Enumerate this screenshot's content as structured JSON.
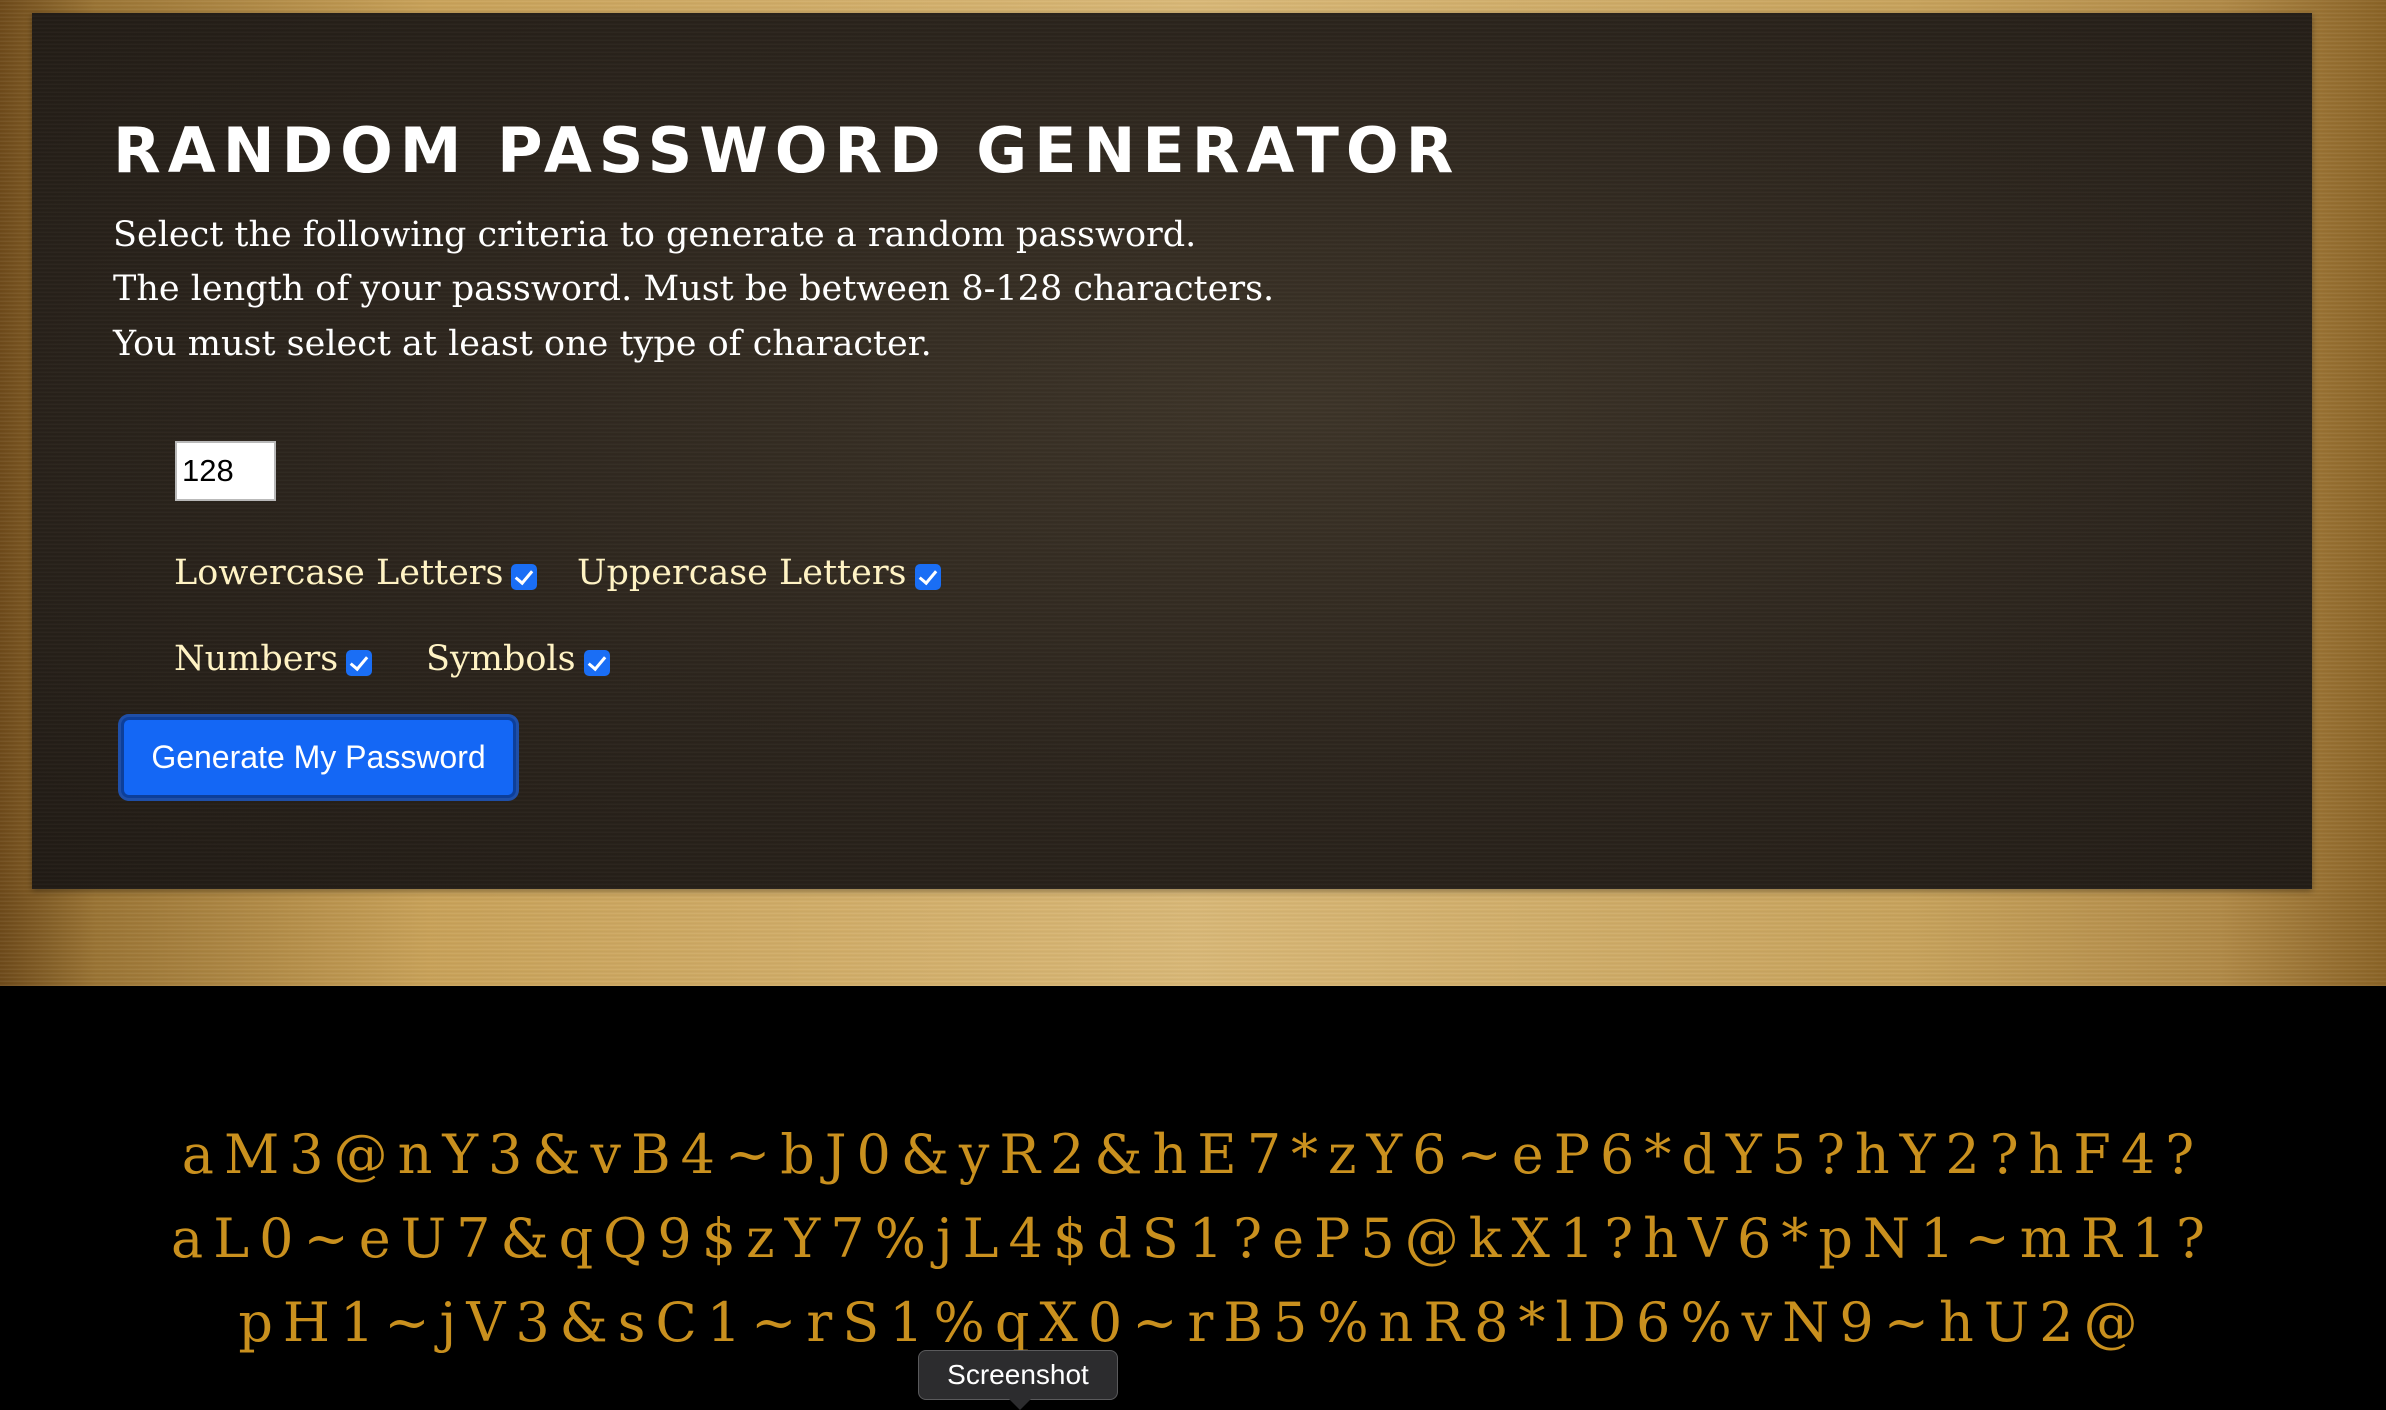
{
  "header": {
    "title": "Random Password Generator"
  },
  "instructions": [
    "Select the following criteria to generate a random password.",
    "The length of your password. Must be between 8-128 characters.",
    "You must select at least one type of character."
  ],
  "length_input": {
    "value": "128"
  },
  "options": {
    "lowercase": {
      "label": "Lowercase Letters",
      "checked": true
    },
    "uppercase": {
      "label": "Uppercase Letters",
      "checked": true
    },
    "numbers": {
      "label": "Numbers",
      "checked": true
    },
    "symbols": {
      "label": "Symbols",
      "checked": true
    }
  },
  "generate_button": {
    "label": "Generate My Password"
  },
  "password_output": {
    "lines": [
      "aM3@nY3&vB4~bJ0&yR2&hE7*zY6~eP6*dY5?hY2?hF4?",
      "aL0~eU7&qQ9$zY7%jL4$dS1?eP5@kX1?hV6*pN1~mR1?",
      "pH1~jV3&sC1~rS1%qX0~rB5%nR8*lD6%vN9~hU2@"
    ]
  },
  "tooltip": {
    "label": "Screenshot"
  },
  "colors": {
    "accent_button": "#1467f5",
    "password_text": "#c9901e",
    "option_label": "#fff3c4"
  }
}
